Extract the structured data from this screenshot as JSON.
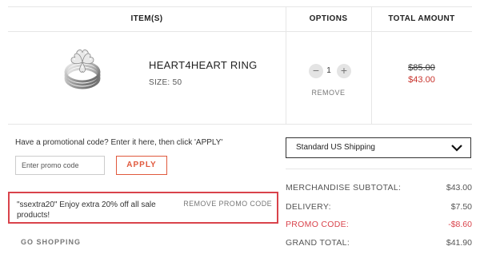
{
  "table": {
    "headers": {
      "items": "ITEM(S)",
      "options": "OPTIONS",
      "total": "TOTAL AMOUNT"
    }
  },
  "product": {
    "name": "HEART4HEART RING",
    "size": "SIZE: 50",
    "quantity": "1",
    "minus": "−",
    "plus": "+",
    "remove": "REMOVE",
    "old_price": "$85.00",
    "new_price": "$43.00",
    "image_icon": "ring-image"
  },
  "promo": {
    "prompt": "Have a promotional code? Enter it here, then click 'APPLY'",
    "placeholder": "Enter promo code",
    "apply_label": "APPLY",
    "applied_message": "\"ssextra20\" Enjoy extra 20% off all sale products!",
    "remove_code_label": "REMOVE PROMO CODE"
  },
  "shipping": {
    "selected": "Standard US Shipping",
    "chevron_icon": "chevron-down-icon"
  },
  "summary": {
    "subtotal_label": "MERCHANDISE SUBTOTAL:",
    "subtotal_value": "$43.00",
    "delivery_label": "DELIVERY:",
    "delivery_value": "$7.50",
    "promo_label": "PROMO CODE:",
    "promo_value": "-$8.60",
    "grand_label": "GRAND TOTAL:",
    "grand_value": "$41.90"
  },
  "nav": {
    "go_shopping": "GO SHOPPING"
  },
  "colors": {
    "accent": "#e0593d",
    "discount": "#c8332c",
    "highlight_border": "#d9434b"
  }
}
